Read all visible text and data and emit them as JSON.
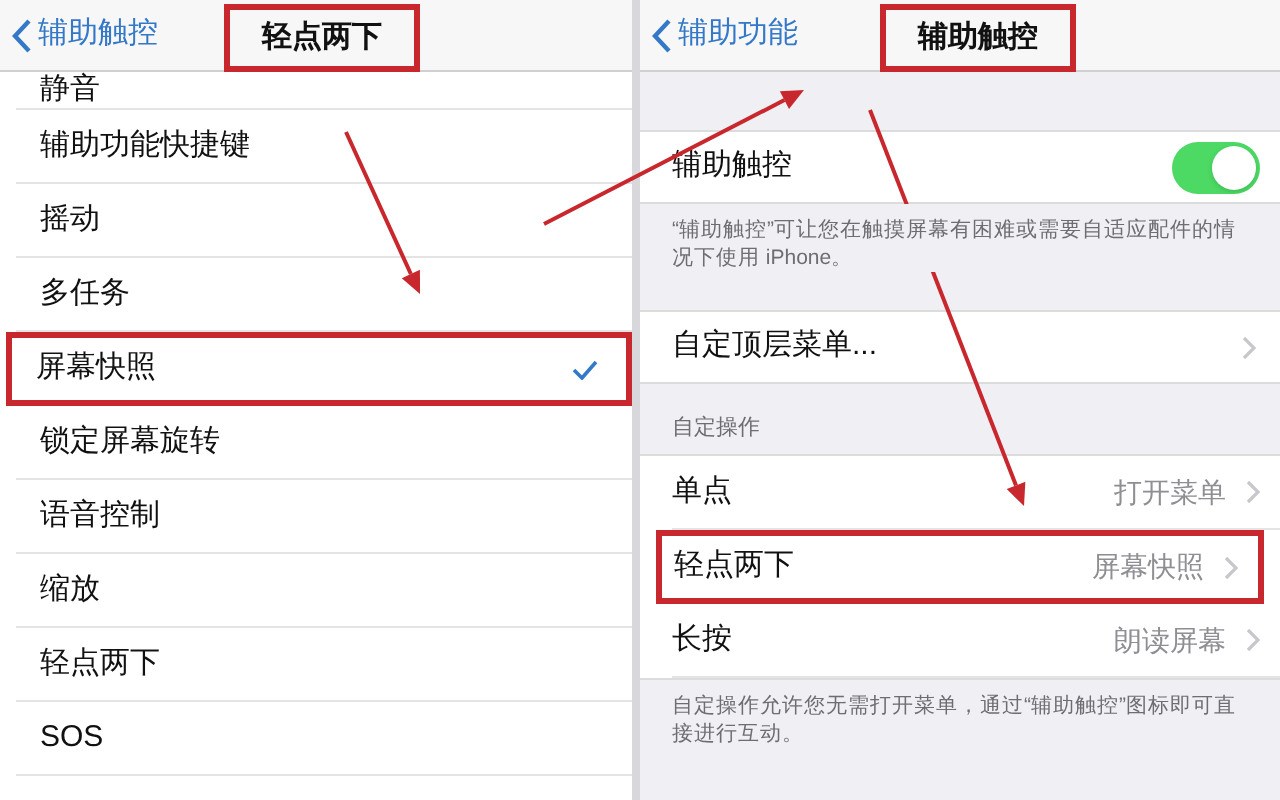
{
  "left_screen": {
    "back_label": "辅助触控",
    "title": "轻点两下",
    "title_highlighted": true,
    "items": [
      {
        "label": "静音",
        "selected": false,
        "highlighted": false
      },
      {
        "label": "辅助功能快捷键",
        "selected": false,
        "highlighted": false
      },
      {
        "label": "摇动",
        "selected": false,
        "highlighted": false
      },
      {
        "label": "多任务",
        "selected": false,
        "highlighted": false
      },
      {
        "label": "屏幕快照",
        "selected": true,
        "highlighted": true
      },
      {
        "label": "锁定屏幕旋转",
        "selected": false,
        "highlighted": false
      },
      {
        "label": "语音控制",
        "selected": false,
        "highlighted": false
      },
      {
        "label": "缩放",
        "selected": false,
        "highlighted": false
      },
      {
        "label": "轻点两下",
        "selected": false,
        "highlighted": false
      },
      {
        "label": "SOS",
        "selected": false,
        "highlighted": false
      }
    ]
  },
  "right_screen": {
    "back_label": "辅助功能",
    "title": "辅助触控",
    "title_highlighted": true,
    "toggle": {
      "label": "辅助触控",
      "on": true
    },
    "toggle_note": "“辅助触控”可让您在触摸屏幕有困难或需要自适应配件的情况下使用 iPhone。",
    "menu_row": {
      "label": "自定顶层菜单..."
    },
    "section_header": "自定操作",
    "actions": [
      {
        "label": "单点",
        "value": "打开菜单",
        "highlighted": false
      },
      {
        "label": "轻点两下",
        "value": "屏幕快照",
        "highlighted": true
      },
      {
        "label": "长按",
        "value": "朗读屏幕",
        "highlighted": false
      }
    ],
    "actions_note": "自定操作允许您无需打开菜单，通过“辅助触控”图标即可直接进行互动。"
  }
}
